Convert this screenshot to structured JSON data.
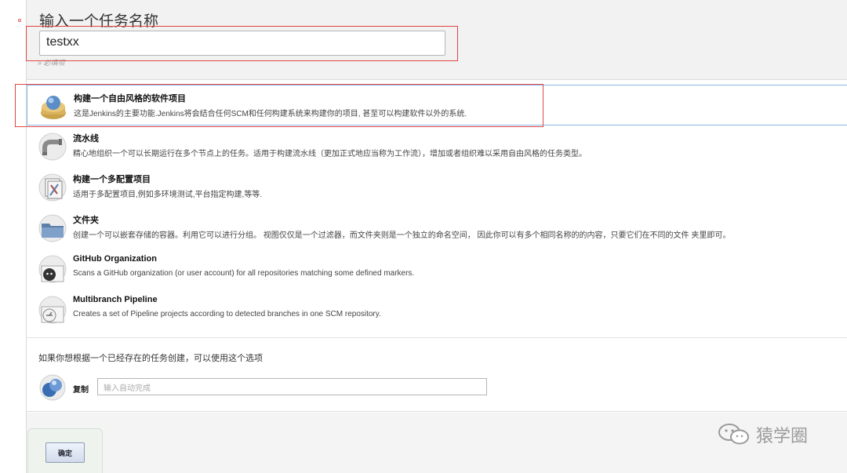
{
  "name_section": {
    "title": "输入一个任务名称",
    "input_value": "testxx",
    "required_hint": "» 必填项"
  },
  "items": [
    {
      "title": "构建一个自由风格的软件项目",
      "description": "这是Jenkins的主要功能.Jenkins将会结合任何SCM和任何构建系统来构建你的项目, 甚至可以构建软件以外的系统.",
      "icon": "freestyle-project-icon"
    },
    {
      "title": "流水线",
      "description": "精心地组织一个可以长期运行在多个节点上的任务。适用于构建流水线（更加正式地应当称为工作流），增加或者组织难以采用自由风格的任务类型。",
      "icon": "pipeline-icon"
    },
    {
      "title": "构建一个多配置项目",
      "description": "适用于多配置项目,例如多环境测试,平台指定构建,等等.",
      "icon": "multi-config-project-icon"
    },
    {
      "title": "文件夹",
      "description": "创建一个可以嵌套存储的容器。利用它可以进行分组。 视图仅仅是一个过滤器，而文件夹则是一个独立的命名空间， 因此你可以有多个相同名称的的内容，只要它们在不同的文件 夹里即可。",
      "icon": "folder-icon"
    },
    {
      "title": "GitHub Organization",
      "description": "Scans a GitHub organization (or user account) for all repositories matching some defined markers.",
      "icon": "github-organization-icon"
    },
    {
      "title": "Multibranch Pipeline",
      "description": "Creates a set of Pipeline projects according to detected branches in one SCM repository.",
      "icon": "multibranch-pipeline-icon"
    }
  ],
  "copy_section": {
    "hint": "如果你想根据一个已经存在的任务创建，可以使用这个选项",
    "label": "复制",
    "placeholder": "输入自动完成"
  },
  "footer": {
    "ok_label": "确定"
  },
  "watermark": {
    "text": "猿学圈"
  },
  "colors": {
    "highlight_red": "#e04646",
    "selected_border": "#8ab7e6",
    "panel_gray": "#f2f2f2"
  }
}
